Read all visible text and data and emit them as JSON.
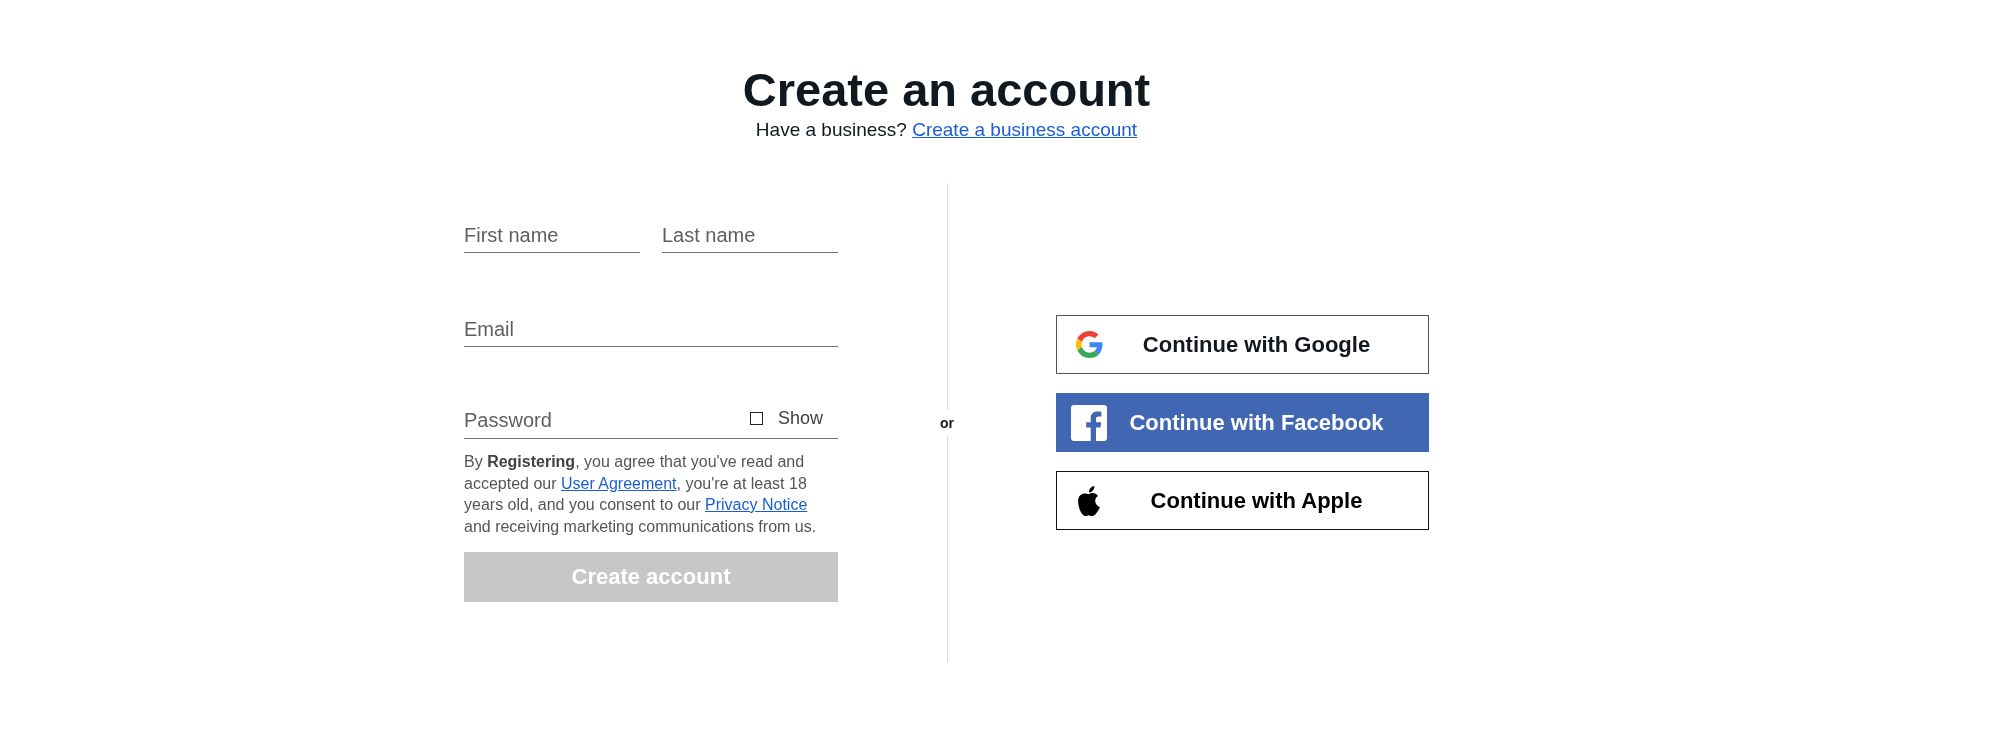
{
  "header": {
    "title": "Create an account",
    "prompt": "Have a business?",
    "business_link": "Create a business account"
  },
  "form": {
    "name_fields": [
      {
        "placeholder": "First name"
      },
      {
        "placeholder": "Last name"
      }
    ],
    "email_field": {
      "placeholder": "Email"
    },
    "password_field": {
      "placeholder": "Password",
      "show_label": "Show",
      "show_checked": false
    },
    "legal": [
      {
        "kind": "text",
        "text": "By **Registering**, you agree that you've read and accepted our "
      },
      {
        "kind": "link",
        "text": "User Agreement"
      },
      {
        "kind": "text",
        "text": ", you're at least 18 years old, and you consent to our "
      },
      {
        "kind": "link",
        "text": "Privacy Notice"
      },
      {
        "kind": "text",
        "text": " and receiving marketing communications from us."
      }
    ],
    "submit": {
      "label": "Create account",
      "disabled": true
    }
  },
  "divider": {
    "label": "or"
  },
  "social_buttons": [
    {
      "kind": "google",
      "label": "Continue with Google"
    },
    {
      "kind": "facebook",
      "label": "Continue with Facebook"
    },
    {
      "kind": "apple",
      "label": "Continue with Apple"
    }
  ]
}
